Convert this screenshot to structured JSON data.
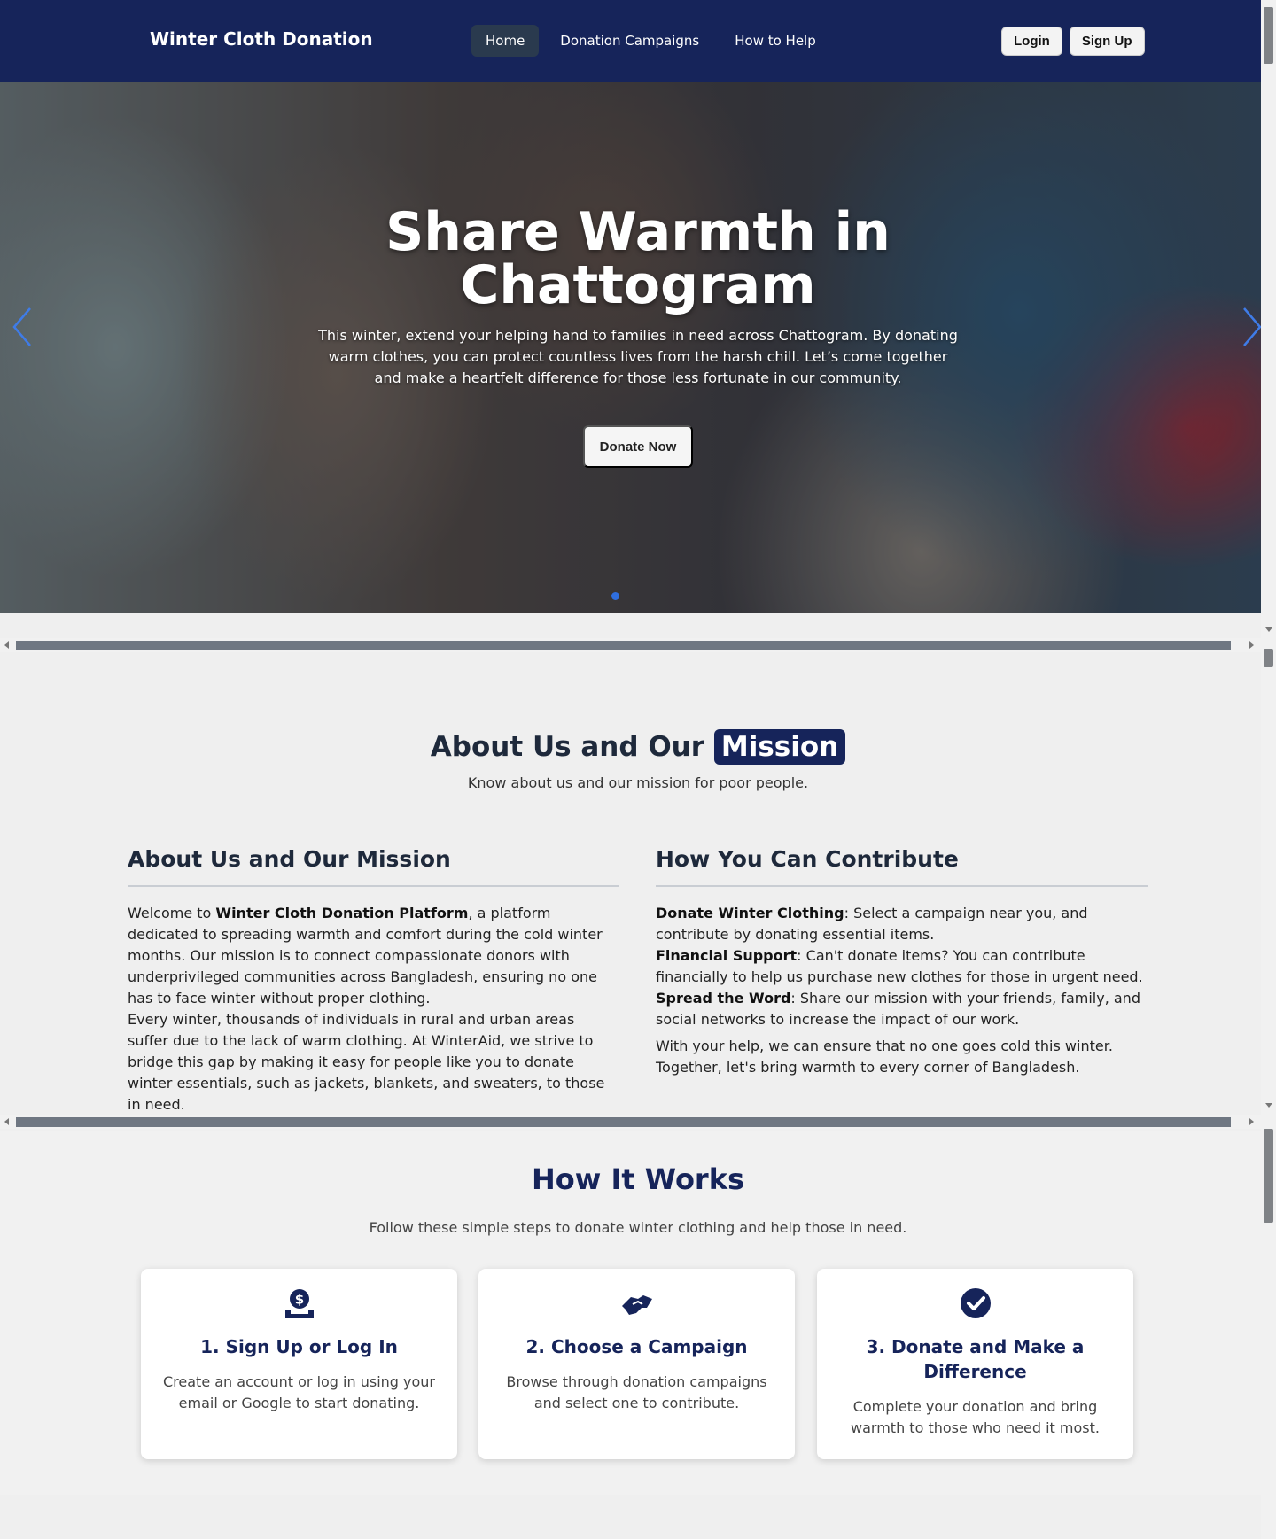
{
  "navbar": {
    "brand": "Winter Cloth Donation",
    "links": [
      "Home",
      "Donation Campaigns",
      "How to Help"
    ],
    "login": "Login",
    "signup": "Sign Up"
  },
  "hero": {
    "title_line1": "Share Warmth in",
    "title_line2": "Chattogram",
    "text": "This winter, extend your helping hand to families in need across Chattogram. By donating warm clothes, you can protect countless lives from the harsh chill. Let’s come together and make a heartfelt difference for those less fortunate in our community.",
    "button": "Donate Now"
  },
  "about": {
    "title_main": "About Us and Our",
    "title_highlight": "Mission",
    "subtitle": "Know about us and our mission for poor people.",
    "left": {
      "heading": "About Us and Our Mission",
      "p1_pre": "Welcome to ",
      "p1_bold": "Winter Cloth Donation Platform",
      "p1_post": ", a platform dedicated to spreading warmth and comfort during the cold winter months. Our mission is to connect compassionate donors with underprivileged communities across Bangladesh, ensuring no one has to face winter without proper clothing.",
      "p2": "Every winter, thousands of individuals in rural and urban areas suffer due to the lack of warm clothing. At WinterAid, we strive to bridge this gap by making it easy for people like you to donate winter essentials, such as jackets, blankets, and sweaters, to those in need."
    },
    "right": {
      "heading": "How You Can Contribute",
      "items": [
        {
          "bold": "Donate Winter Clothing",
          "text": ": Select a campaign near you, and contribute by donating essential items."
        },
        {
          "bold": "Financial Support",
          "text": ": Can't donate items? You can contribute financially to help us purchase new clothes for those in urgent need."
        },
        {
          "bold": "Spread the Word",
          "text": ": Share our mission with your friends, family, and social networks to increase the impact of our work."
        }
      ],
      "closing": "With your help, we can ensure that no one goes cold this winter. Together, let's bring warmth to every corner of Bangladesh."
    }
  },
  "how_it_works": {
    "title": "How It Works",
    "subtitle": "Follow these simple steps to donate winter clothing and help those in need.",
    "steps": [
      {
        "icon": "hand-holding-dollar-icon",
        "title": "1. Sign Up or Log In",
        "text": "Create an account or log in using your email or Google to start donating."
      },
      {
        "icon": "handshake-icon",
        "title": "2. Choose a Campaign",
        "text": "Browse through donation campaigns and select one to contribute."
      },
      {
        "icon": "check-circle-icon",
        "title": "3. Donate and Make a Difference",
        "text": "Complete your donation and bring warmth to those who need it most."
      }
    ]
  },
  "colors": {
    "navy": "#16245a",
    "accent_blue": "#2f6fe0"
  }
}
